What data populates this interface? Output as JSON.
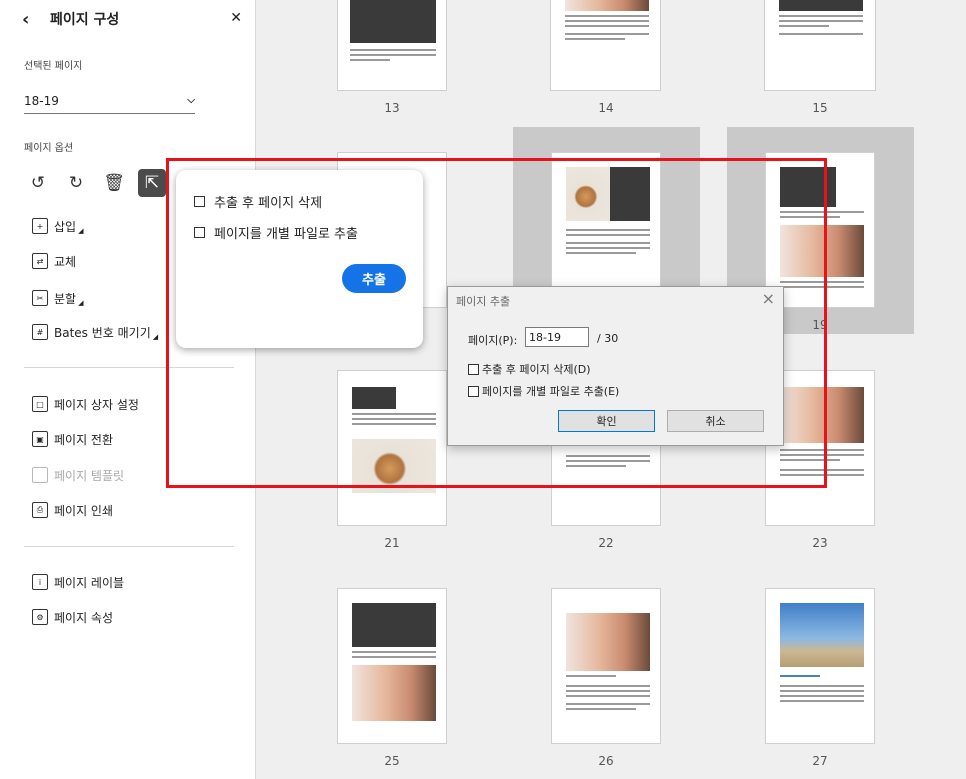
{
  "sidebar": {
    "title": "페이지 구성",
    "selected_pages_label": "선택된 페이지",
    "selected_pages_value": "18-19",
    "page_options_label": "페이지 옵션",
    "items": [
      {
        "label": "삽입",
        "icon": "insert-page-icon",
        "disabled": false,
        "submenu": true
      },
      {
        "label": "교체",
        "icon": "replace-page-icon",
        "disabled": false,
        "submenu": false
      },
      {
        "label": "분할",
        "icon": "split-page-icon",
        "disabled": false,
        "submenu": true
      },
      {
        "label": "Bates 번호 매기기",
        "icon": "bates-numbering-icon",
        "disabled": false,
        "submenu": true
      }
    ],
    "items2": [
      {
        "label": "페이지 상자 설정",
        "icon": "page-box-icon",
        "disabled": false
      },
      {
        "label": "페이지 전환",
        "icon": "page-transition-icon",
        "disabled": false
      },
      {
        "label": "페이지 템플릿",
        "icon": "page-template-icon",
        "disabled": true
      },
      {
        "label": "페이지 인쇄",
        "icon": "print-icon",
        "disabled": false
      }
    ],
    "items3": [
      {
        "label": "페이지 레이블",
        "icon": "page-label-icon",
        "disabled": false
      },
      {
        "label": "페이지 속성",
        "icon": "page-properties-icon",
        "disabled": false
      }
    ]
  },
  "popover": {
    "delete_after_extract": "추출 후 페이지 삭제",
    "extract_as_separate": "페이지를 개별 파일로 추출",
    "extract_button": "추출"
  },
  "dialog": {
    "title": "페이지 추출",
    "pages_label": "페이지(P):",
    "pages_value": "18-19",
    "pages_total": "/ 30",
    "delete_after_extract": "추출 후 페이지 삭제(D)",
    "extract_as_separate": "페이지를 개별 파일로 추출(E)",
    "ok_button": "확인",
    "cancel_button": "취소"
  },
  "pages": {
    "p13": "13",
    "p14": "14",
    "p15": "15",
    "p19": "19",
    "p21": "21",
    "p22": "22",
    "p23": "23",
    "p25": "25",
    "p26": "26",
    "p27": "27"
  },
  "colors": {
    "accent": "#1473e6",
    "highlight_box": "#e8131a"
  }
}
